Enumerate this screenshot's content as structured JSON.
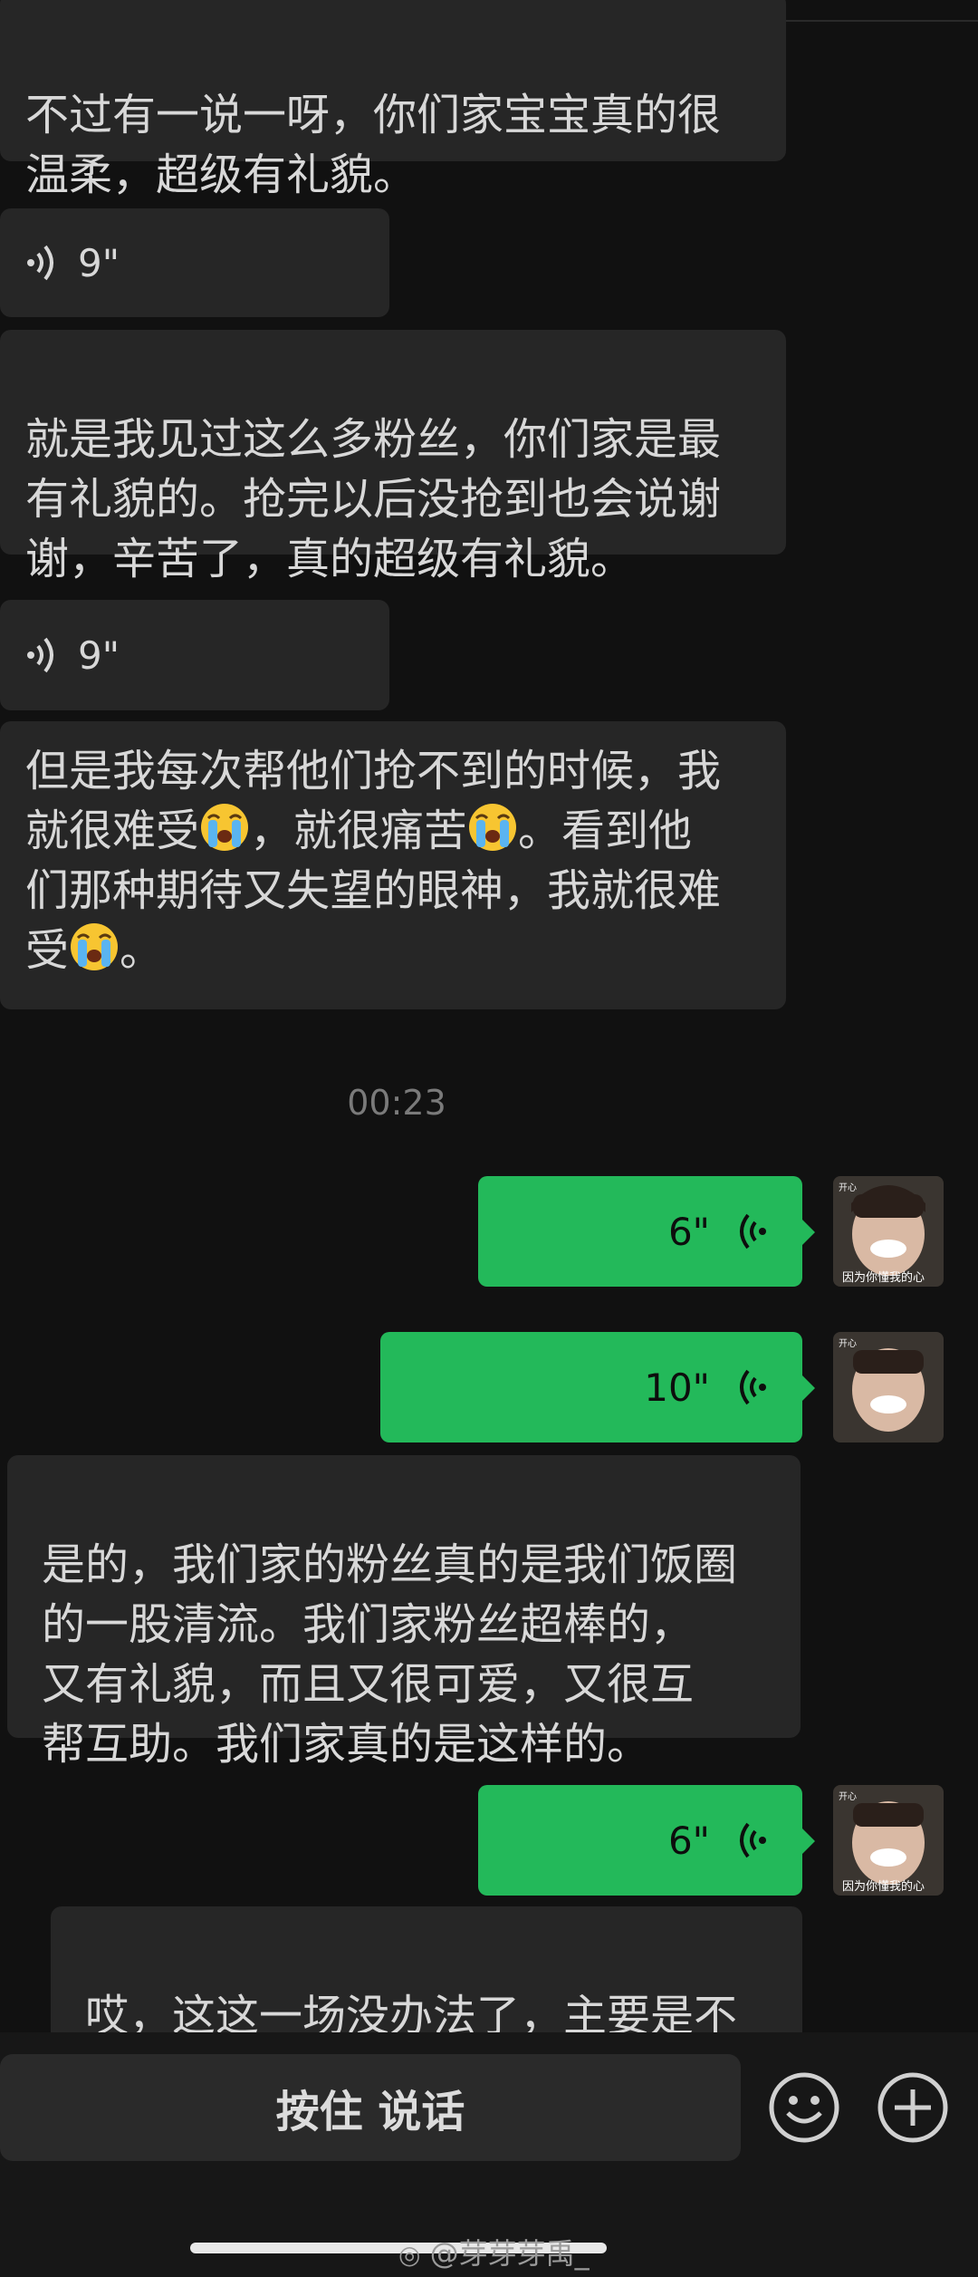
{
  "messages": {
    "m1": "不过有一说一呀，你们家宝宝真的很\n温柔，超级有礼貌。",
    "v1": "9\"",
    "m2": "就是我见过这么多粉丝，你们家是最\n有礼貌的。抢完以后没抢到也会说谢\n谢，辛苦了，真的超级有礼貌。",
    "v2": "9\"",
    "m3_a": "但是我每次帮他们抢不到的时候，我",
    "m3_b1": "就很难受",
    "m3_b2": "，就很痛苦",
    "m3_b3": "。看到他",
    "m3_c": "们那种期待又失望的眼神，我就很难",
    "m3_d1": "受",
    "m3_d2": "。",
    "time": "00:23",
    "v3": "6\"",
    "v4": "10\"",
    "m4": "是的，我们家的粉丝真的是我们饭圈\n的一股清流。我们家粉丝超棒的，\n又有礼貌，而且又很可爱，又很互\n帮互助。我们家真的是这样的。",
    "v5": "6\"",
    "m5": "哎，这这一场没办法了，主要是不\n可控因素太多了。"
  },
  "avatar": {
    "top_text": "开心",
    "caption": "因为你懂我的心"
  },
  "input": {
    "hold_label": "按住 说话"
  },
  "watermark": "@芽芽芽禹_",
  "colors": {
    "background": "#111111",
    "incoming_bubble": "#262626",
    "outgoing_bubble": "#23b95a"
  }
}
